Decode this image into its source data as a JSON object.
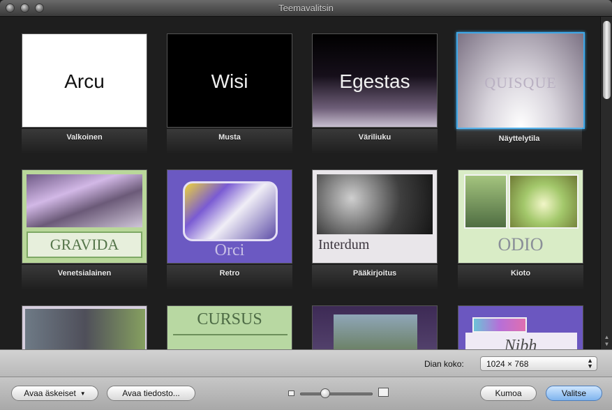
{
  "window": {
    "title": "Teemavalitsin"
  },
  "themes": [
    {
      "thumb_text": "Arcu",
      "label": "Valkoinen",
      "style": "t-white"
    },
    {
      "thumb_text": "Wisi",
      "label": "Musta",
      "style": "t-black"
    },
    {
      "thumb_text": "Egestas",
      "label": "Väriliuku",
      "style": "t-grad"
    },
    {
      "thumb_text": "QUISQUE",
      "label": "Näyttelytila",
      "style": "t-showroom",
      "selected": true
    },
    {
      "thumb_text": "GRAVIDA",
      "label": "Venetsialainen",
      "style": "t-venetian"
    },
    {
      "thumb_text": "Orci",
      "label": "Retro",
      "style": "t-retro"
    },
    {
      "thumb_text": "Interdum",
      "label": "Pääkirjoitus",
      "style": "t-dark"
    },
    {
      "thumb_text": "ODIO",
      "label": "Kioto",
      "style": "t-kyoto"
    },
    {
      "thumb_text": "",
      "label": "",
      "style": "t-row3a"
    },
    {
      "thumb_text": "CURSUS",
      "label": "",
      "style": "t-row3b"
    },
    {
      "thumb_text": "",
      "label": "",
      "style": "t-row3c"
    },
    {
      "thumb_text": "Nibh",
      "label": "",
      "style": "t-row3d"
    }
  ],
  "slide_size": {
    "label": "Dian koko:",
    "value": "1024 × 768"
  },
  "buttons": {
    "open_recent": "Avaa äskeiset",
    "open_file": "Avaa tiedosto...",
    "cancel": "Kumoa",
    "choose": "Valitse"
  },
  "zoom": {
    "level": 0.35
  },
  "scroll": {
    "position": 0.0
  },
  "colors": {
    "selection": "#3fa8e8",
    "background": "#1e1e1e"
  }
}
